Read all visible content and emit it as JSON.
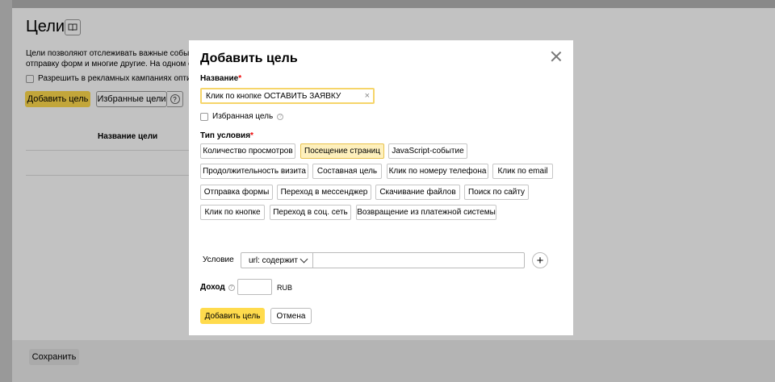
{
  "background": {
    "title": "Цели",
    "book_icon": "book-icon",
    "description_line1": "Цели позволяют отслеживать важные события н",
    "description_line2": "отправку форм и многие другие. На одном счетч",
    "ads_checkbox_label": "Разрешить в рекламных кампаниях оптимиз",
    "add_goal_button": "Добавить цель",
    "favorites_button": "Избранные цели",
    "help_icon_glyph": "?",
    "column_header": "Название цели",
    "save_button": "Сохранить"
  },
  "modal": {
    "title": "Добавить цель",
    "name_label": "Название",
    "required_mark": "*",
    "name_value": "Клик по кнопке ОСТАВИТЬ ЗАЯВКУ",
    "clear_glyph": "×",
    "favorite_label": "Избранная цель",
    "condition_type_label": "Тип условия",
    "condition_types": [
      {
        "label": "Количество просмотров",
        "active": false
      },
      {
        "label": "Посещение страниц",
        "active": true
      },
      {
        "label": "JavaScript-событие",
        "active": false
      },
      {
        "label": "Продолжительность визита",
        "active": false
      },
      {
        "label": "Составная цель",
        "active": false
      },
      {
        "label": "Клик по номеру телефона",
        "active": false
      },
      {
        "label": "Клик по email",
        "active": false
      },
      {
        "label": "Отправка формы",
        "active": false
      },
      {
        "label": "Переход в мессенджер",
        "active": false
      },
      {
        "label": "Скачивание файлов",
        "active": false
      },
      {
        "label": "Поиск по сайту",
        "active": false
      },
      {
        "label": "Клик по кнопке",
        "active": false
      },
      {
        "label": "Переход в соц. сеть",
        "active": false
      },
      {
        "label": "Возвращение из платежной системы",
        "active": false
      }
    ],
    "condition_label": "Условие",
    "condition_select_value": "url: содержит",
    "condition_input_value": "",
    "plus_glyph": "+",
    "income_label": "Доход",
    "income_value": "",
    "currency": "RUB",
    "submit_button": "Добавить цель",
    "cancel_button": "Отмена"
  },
  "colors": {
    "accent_yellow": "#ffdb4d",
    "active_chip": "#fef0bd",
    "required": "#ee0000"
  }
}
